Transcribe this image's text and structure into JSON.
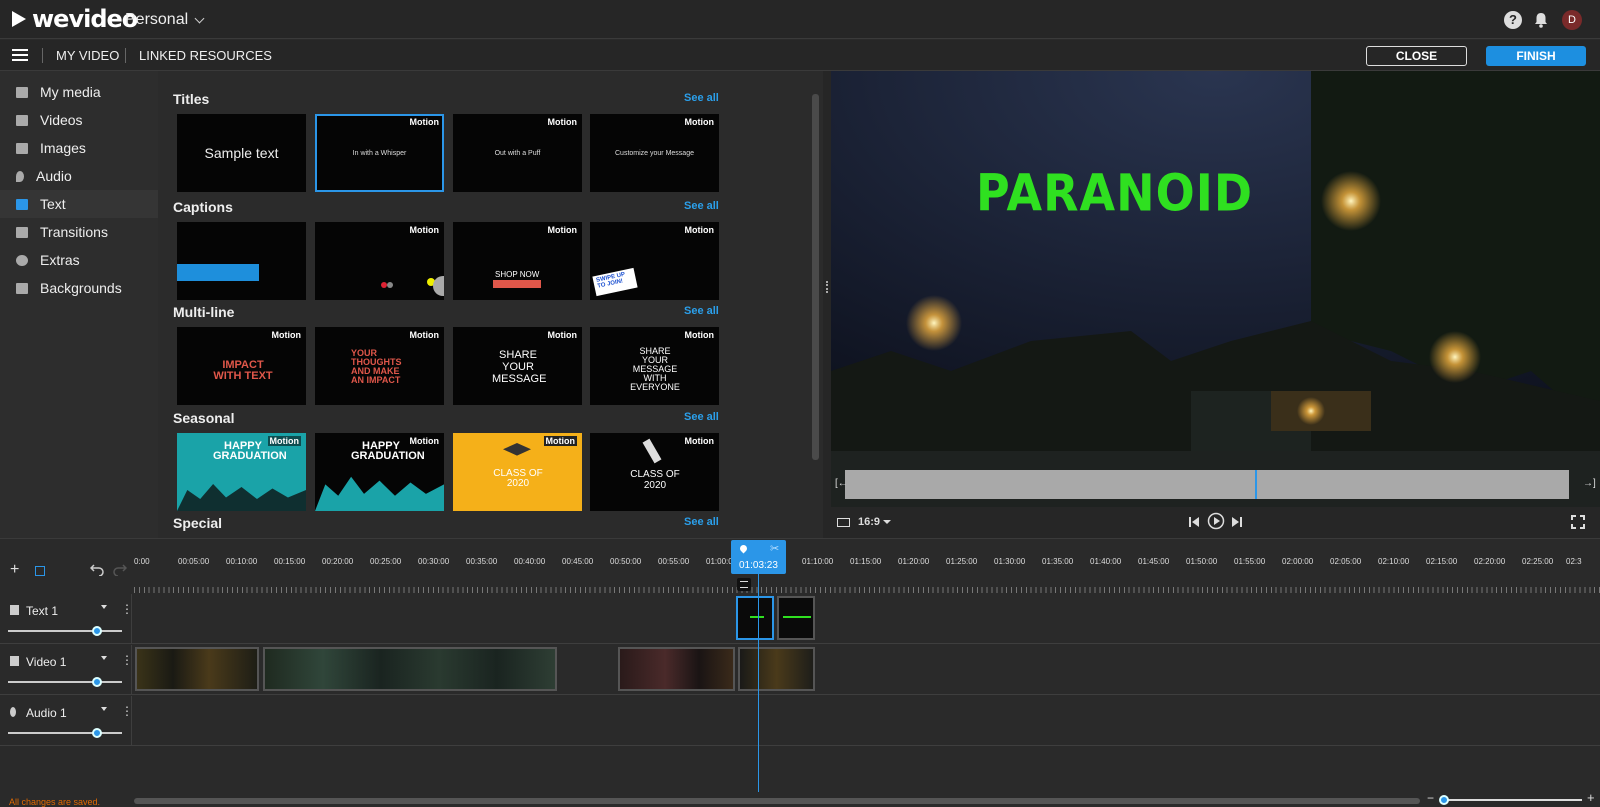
{
  "app": {
    "brand": "wevideo",
    "workspace": "Personal",
    "avatar_initial": "D"
  },
  "toolbar": {
    "my_video": "MY VIDEO",
    "linked": "LINKED RESOURCES",
    "close": "CLOSE",
    "finish": "FINISH"
  },
  "sidebar": {
    "items": [
      {
        "label": "My media",
        "icon": "folder-image-icon"
      },
      {
        "label": "Videos",
        "icon": "video-icon"
      },
      {
        "label": "Images",
        "icon": "image-icon"
      },
      {
        "label": "Audio",
        "icon": "music-note-icon"
      },
      {
        "label": "Text",
        "icon": "text-icon",
        "active": true
      },
      {
        "label": "Transitions",
        "icon": "transition-icon"
      },
      {
        "label": "Extras",
        "icon": "smiley-icon"
      },
      {
        "label": "Backgrounds",
        "icon": "backgrounds-icon"
      }
    ]
  },
  "library": {
    "see_all": "See all",
    "motion": "Motion",
    "sections": [
      {
        "title": "Titles",
        "thumbs": [
          "Sample text",
          "In with a Whisper",
          "Out with a Puff",
          "Customize your Message"
        ]
      },
      {
        "title": "Captions",
        "thumbs": [
          "",
          "",
          "SHOP NOW",
          "SWIPE UP TO JOIN!"
        ]
      },
      {
        "title": "Multi-line",
        "thumbs": [
          "IMPACT WITH TEXT",
          "YOUR THOUGHTS AND MAKE AN IMPACT",
          "SHARE YOUR MESSAGE",
          "SHARE YOUR MESSAGE WITH EVERYONE"
        ]
      },
      {
        "title": "Seasonal",
        "thumbs": [
          "HAPPY GRADUATION",
          "HAPPY GRADUATION",
          "CLASS OF 2020",
          "CLASS OF 2020"
        ]
      },
      {
        "title": "Special"
      }
    ]
  },
  "preview": {
    "title_overlay": "PARANOID",
    "aspect": "16:9"
  },
  "timeline": {
    "playhead_time": "01:03:23",
    "ticks": [
      "0:00",
      "00:05:00",
      "00:10:00",
      "00:15:00",
      "00:20:00",
      "00:25:00",
      "00:30:00",
      "00:35:00",
      "00:40:00",
      "00:45:00",
      "00:50:00",
      "00:55:00",
      "01:00:0",
      "01:10:00",
      "01:15:00",
      "01:20:00",
      "01:25:00",
      "01:30:00",
      "01:35:00",
      "01:40:00",
      "01:45:00",
      "01:50:00",
      "01:55:00",
      "02:00:00",
      "02:05:00",
      "02:10:00",
      "02:15:00",
      "02:20:00",
      "02:25:00",
      "02:3"
    ],
    "tracks": [
      "Text 1",
      "Video 1",
      "Audio 1"
    ],
    "volume_levels": [
      0.75,
      0.75,
      0.75
    ]
  },
  "status": "All changes are saved.",
  "colors": {
    "accent": "#2b96e8",
    "overlay_green": "#2fe020",
    "status_orange": "#e06a00"
  }
}
